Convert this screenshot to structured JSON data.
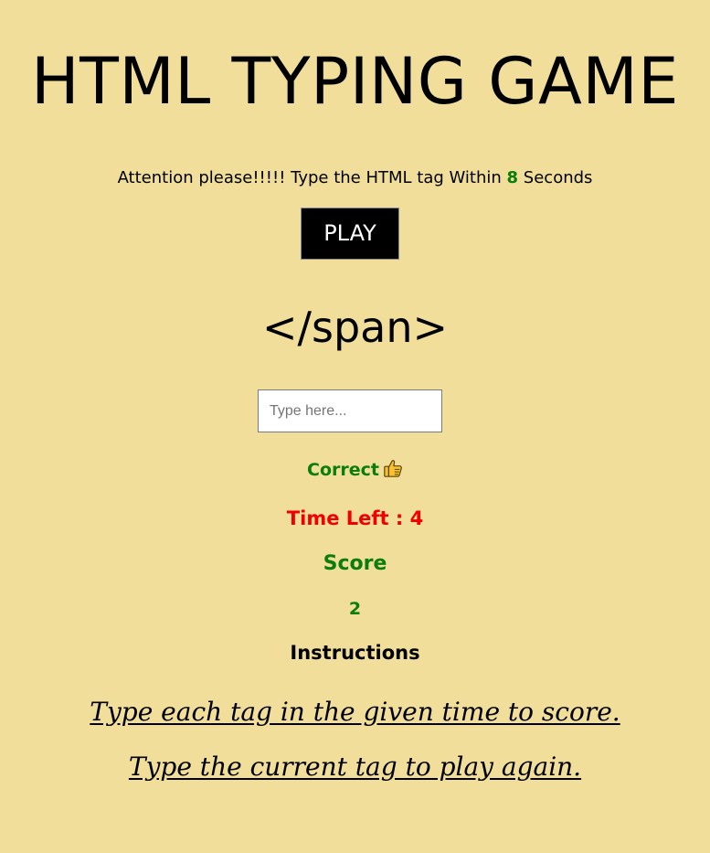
{
  "header": {
    "title": "HTML TYPING GAME"
  },
  "notice": {
    "prefix": "Attention please!!!!! Type the HTML tag Within",
    "seconds": "8",
    "suffix": "Seconds"
  },
  "controls": {
    "play_label": "PLAY"
  },
  "game": {
    "current_tag": "</span>",
    "input_placeholder": "Type here...",
    "input_value": "",
    "feedback": "Correct",
    "feedback_icon": "thumbs-up-icon",
    "time_left_label": "Time Left : ",
    "time_left_value": "4",
    "score_label": "Score",
    "score_value": "2"
  },
  "instructions": {
    "heading": "Instructions",
    "lines": [
      "Type each tag in the given time to score.",
      "Type the current tag to play again."
    ]
  },
  "colors": {
    "background": "#f0de9a",
    "correct_green": "#0a7d0a",
    "timer_red": "#f00000",
    "button_black": "#000000"
  }
}
